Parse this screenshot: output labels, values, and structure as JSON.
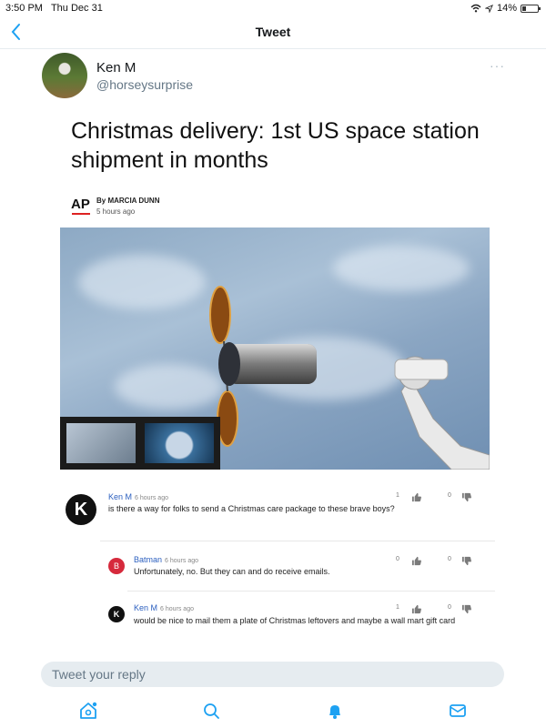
{
  "status_bar": {
    "time": "3:50 PM",
    "date": "Thu Dec 31",
    "battery": "14%"
  },
  "nav": {
    "title": "Tweet",
    "back_icon": "chevron-left-icon"
  },
  "tweet": {
    "author_name": "Ken M",
    "author_handle": "@horseysurprise",
    "more": "···"
  },
  "article": {
    "headline": "Christmas delivery: 1st US space station shipment in months",
    "source": "AP",
    "byline": "By MARCIA DUNN",
    "time": "5 hours ago"
  },
  "comments": [
    {
      "avatar": "K",
      "name": "Ken M",
      "time": "6 hours ago",
      "text": "is there a way for folks to send a Christmas care package to these brave boys?",
      "likes": "1",
      "dislikes": "0"
    },
    {
      "avatar": "B",
      "name": "Batman",
      "time": "6 hours ago",
      "text": "Unfortunately, no. But they can and do receive emails.",
      "likes": "0",
      "dislikes": "0"
    },
    {
      "avatar": "K",
      "name": "Ken M",
      "time": "6 hours ago",
      "text": "would be nice to mail them a plate of Christmas leftovers and maybe a wall mart gift card",
      "likes": "1",
      "dislikes": "0"
    }
  ],
  "reply": {
    "placeholder": "Tweet your reply"
  },
  "tabs": [
    "home-icon",
    "search-icon",
    "notifications-icon",
    "messages-icon"
  ],
  "colors": {
    "accent": "#1da1f2",
    "batman_red": "#d62a3c",
    "comment_name": "#2b5fbf"
  }
}
